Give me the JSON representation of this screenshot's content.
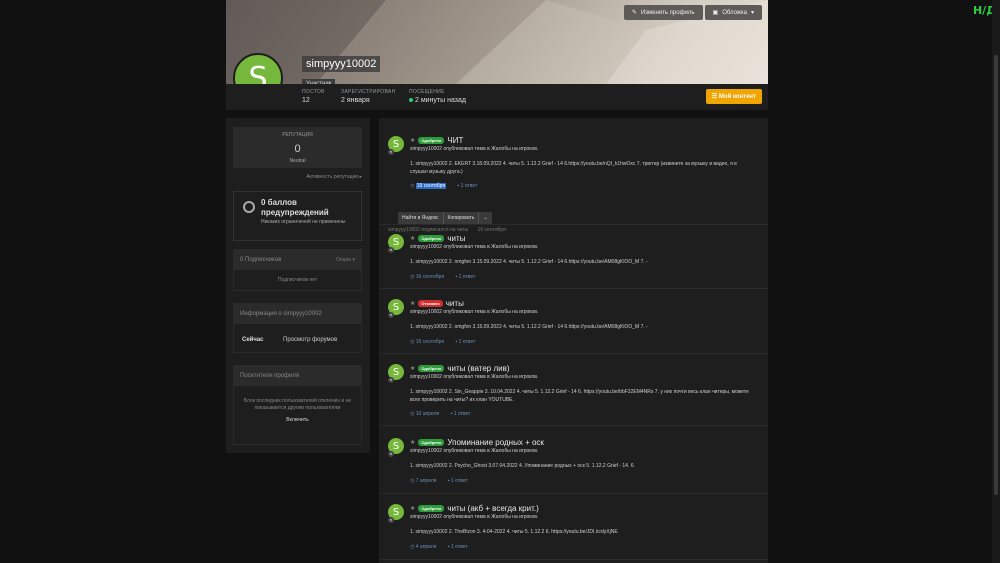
{
  "corner_badge": "Н/Д",
  "colors": {
    "accent": "#f0a500",
    "approved": "#2e9b3c",
    "rejected": "#d12f2f",
    "avatar": "#76b83b"
  },
  "cover": {
    "edit_profile": "Изменить профиль",
    "cover_button": "Обложка",
    "avatar_letter": "S",
    "username": "simpyyy10002",
    "role": "Участник"
  },
  "stats": {
    "posts_label": "ПОСТОВ",
    "posts_value": "12",
    "registered_label": "ЗАРЕГИСТРИРОВАН",
    "registered_value": "2 января",
    "visit_label": "ПОСЕЩЕНИЕ",
    "visit_value": "2 минуты назад",
    "my_content": "Мой контент"
  },
  "sidebar": {
    "rep_label": "РЕПУТАЦИЯ",
    "rep_value": "0",
    "rep_sub": "Neutral",
    "rep_link": "Активность репутации",
    "warn_title": "0 баллов предупреждений",
    "warn_sub": "Никаких ограничений не применены",
    "subs_title": "0 Подписчиков",
    "subs_opts": "Опции",
    "subs_empty": "Подписчиков нет",
    "info_title": "Информация о simpyyy10002",
    "info_key": "Сейчас",
    "info_val": "Просмотр форумов",
    "visitors_title": "Посетители профиля",
    "visitors_text": "Блок последних пользователей отключён и не показывается другим пользователям",
    "enable": "Включить"
  },
  "context_menu": {
    "yandex": "Найти в Яндекс",
    "copy": "Копировать"
  },
  "follow_line": {
    "text": "simpyyy10002 подписался на читы",
    "date": "16 сентября"
  },
  "posts": [
    {
      "badge": "Одобрено",
      "status": "ok",
      "title": "ЧИТ",
      "sub": "simpyyy10002 опубликовал тема в Жалобы на игроков.",
      "body": "1. simpyyy10002 2. EKERT 3.18.09.2022 4. читы 5. 1.12.2 Grief - 14 6.https://youtu.be/nQI_k1hwOxc 7. триггер (извините за музыку в видео, я в слушал музыку друга.)",
      "date": "19 сентября",
      "replies": "1 ответ"
    },
    {
      "badge": "Одобрено",
      "status": "ok",
      "title": "читы",
      "sub": "simpyyy10002 опубликовал тема в Жалобы на игроков.",
      "body": "1. simpyyy10002 2. omgfon 3.15.09.2022 4. читы 5. 1.12.2 Grief - 14 6.https://youtu.be/AM08gKlOO_M 7. -",
      "date": "16 сентября",
      "replies": "1 ответ"
    },
    {
      "badge": "Отказано",
      "status": "no",
      "title": "читы",
      "sub": "simpyyy10002 опубликовал тема в Жалобы на игроков.",
      "body": "1. simpyyy10002 2. omgfon 3.15.09.2022 4. читы 5. 1.12.2 Grief - 14 6.https://youtu.be/AM08gKlOO_M 7. -",
      "date": "15 сентября",
      "replies": "1 ответ"
    },
    {
      "badge": "Одобрено",
      "status": "ok",
      "title": "читы (ватер лив)",
      "sub": "simpyyy10002 опубликовал тема в Жалобы на игроков.",
      "body": "1. simpyyy10002 2. Sin_Geappie 3. 10.04.2022 4. читы 5. 1.12.2 Grief - 14 6. https://youtu.be/bbF32EM4NRs 7. у них почти весь клан читеры, можете всех проверить на читы? их клан YOUTUBE.",
      "date": "10 апреля",
      "replies": "1 ответ"
    },
    {
      "badge": "Одобрено",
      "status": "ok",
      "title": "Упоминание родных + оск",
      "sub": "simpyyy10002 опубликовал тема в Жалобы на игроков.",
      "body": "1. simpyyy10002 2. Psycho_Ghost 3.07.04.2022 4. Упоминание родных + оск 5. 1.12.2 Grief - 14. 6.",
      "date": "7 апреля",
      "replies": "1 ответ"
    },
    {
      "badge": "Одобрено",
      "status": "ok",
      "title": "читы (акб + всегда крит.)",
      "sub": "simpyyy10002 опубликовал тема в Жалобы на игроков.",
      "body": "1. simpyyy10002 2. TheBizon 3. 4-04-2022 4. читы 5. 1.12.2 6. https://youtu.be/JDI.lcrdyXjNE",
      "date": "4 апреля",
      "replies": "1 ответ"
    }
  ]
}
